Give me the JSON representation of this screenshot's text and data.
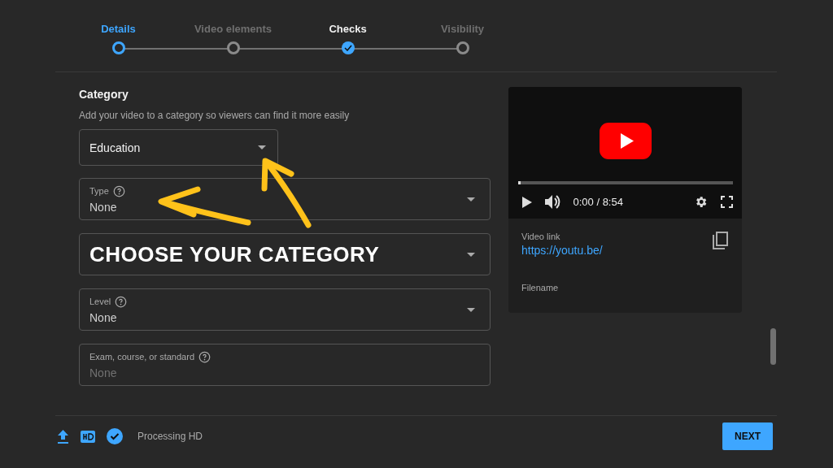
{
  "steps": [
    {
      "label": "Details",
      "selected": true,
      "done": false
    },
    {
      "label": "Video elements",
      "selected": false,
      "done": false
    },
    {
      "label": "Checks",
      "selected": false,
      "done": true
    },
    {
      "label": "Visibility",
      "selected": false,
      "done": false
    }
  ],
  "category": {
    "title": "Category",
    "description": "Add your video to a category so viewers can find it more easily",
    "value": "Education"
  },
  "fields": [
    {
      "kind": "select",
      "label": "Type",
      "value": "None"
    },
    {
      "kind": "banner",
      "value": "CHOOSE YOUR CATEGORY"
    },
    {
      "kind": "select",
      "label": "Level",
      "value": "None"
    },
    {
      "kind": "input",
      "label": "Exam, course, or standard",
      "placeholder": "None"
    }
  ],
  "video": {
    "progress": {
      "level": 0.01
    },
    "time": "0:00 / 8:54",
    "link_label": "Video link",
    "link": "https://youtu.be/",
    "filename_label": "Filename"
  },
  "footer": {
    "status": "Processing HD",
    "button": "NEXT"
  }
}
